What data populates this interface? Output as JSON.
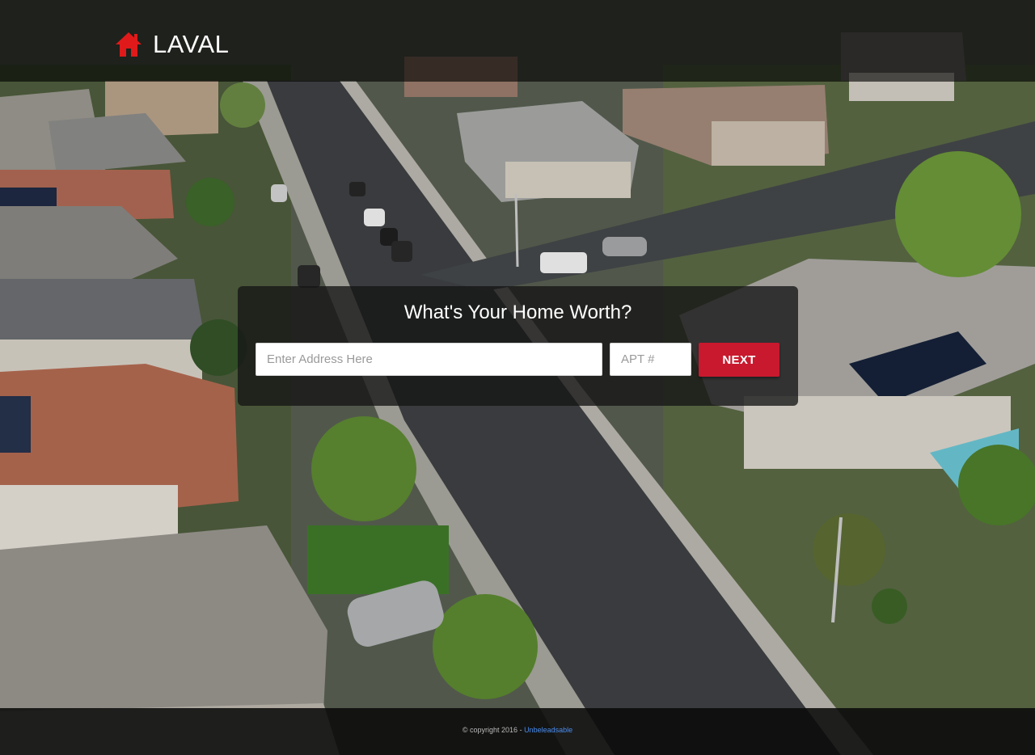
{
  "header": {
    "brand_name": "LAVAL",
    "brand_icon": "home-icon",
    "brand_icon_color": "#e01a1a"
  },
  "form": {
    "title": "What's Your Home Worth?",
    "address_placeholder": "Enter Address Here",
    "address_value": "",
    "apt_placeholder": "APT #",
    "apt_value": "",
    "next_label": "NEXT",
    "next_color": "#c8192e"
  },
  "footer": {
    "copyright_text": "© copyright 2016 - ",
    "link_text": "Unbeleadsable",
    "link_color": "#4a8df0"
  }
}
